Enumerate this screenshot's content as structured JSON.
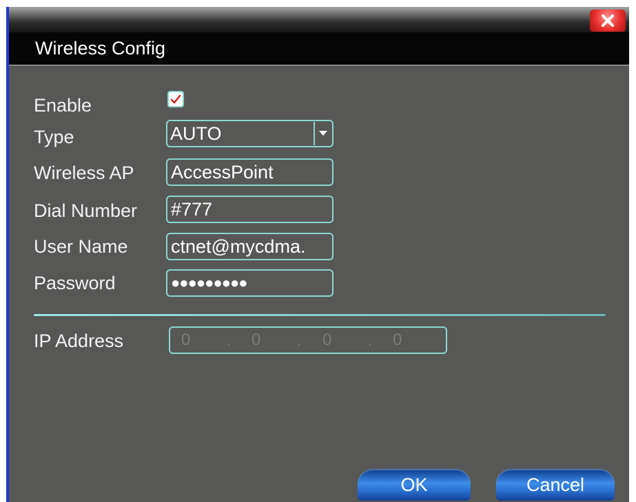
{
  "dialog": {
    "title": "Wireless Config"
  },
  "form": {
    "enable_label": "Enable",
    "enabled": true,
    "type_label": "Type",
    "type_value": "AUTO",
    "ap_label": "Wireless AP",
    "ap_value": "AccessPoint",
    "dial_label": "Dial Number",
    "dial_value": "#777",
    "user_label": "User Name",
    "user_value": "ctnet@mycdma.",
    "password_label": "Password",
    "password_mask": "●●●●●●●●●",
    "ip_label": "IP Address",
    "ip": [
      "0",
      "0",
      "0",
      "0"
    ],
    "ip_separator": "."
  },
  "buttons": {
    "ok": "OK",
    "cancel": "Cancel"
  },
  "icons": {
    "close": "close-icon",
    "dropdown": "chevron-down-icon",
    "check": "checkmark-icon"
  },
  "colors": {
    "panel": "#575856",
    "field_border": "#8cd6d0",
    "close_button": "#e8302e",
    "button_blue": "#3d8be8",
    "window_edge": "#1d3bd6"
  }
}
